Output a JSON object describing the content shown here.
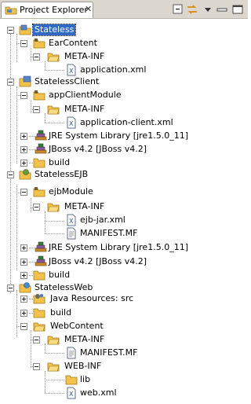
{
  "view": {
    "title": "Project Explorer",
    "close_glyph": "✕",
    "toolbar": [
      {
        "name": "collapse-all-icon"
      },
      {
        "name": "link-with-editor-icon"
      },
      {
        "name": "view-menu-icon"
      },
      {
        "name": "minimize-icon"
      },
      {
        "name": "maximize-icon"
      }
    ]
  },
  "tree": {
    "stateless": "Stateless",
    "ear_content": "EarContent",
    "ear_meta_inf": "META-INF",
    "application_xml": "application.xml",
    "stateless_client": "StatelessClient",
    "app_client_module": "appClientModule",
    "client_meta_inf": "META-INF",
    "application_client_xml": "application-client.xml",
    "client_jre": "JRE System Library [jre1.5.0_11]",
    "client_jboss": "JBoss v4.2 [JBoss v4.2]",
    "client_build": "build",
    "stateless_ejb": "StatelessEJB",
    "ejb_module": "ejbModule",
    "ejb_meta_inf": "META-INF",
    "ejb_jar_xml": "ejb-jar.xml",
    "ejb_manifest": "MANIFEST.MF",
    "ejb_jre": "JRE System Library [jre1.5.0_11]",
    "ejb_jboss": "JBoss v4.2 [JBoss v4.2]",
    "ejb_build": "build",
    "stateless_web": "StatelessWeb",
    "java_resources": "Java Resources: src",
    "web_build": "build",
    "web_content": "WebContent",
    "web_meta_inf": "META-INF",
    "web_manifest": "MANIFEST.MF",
    "web_inf": "WEB-INF",
    "lib": "lib",
    "web_xml": "web.xml"
  },
  "colors": {
    "selection": "#316ac5",
    "folder": "#f2c24d",
    "project": "#5b84c4"
  }
}
